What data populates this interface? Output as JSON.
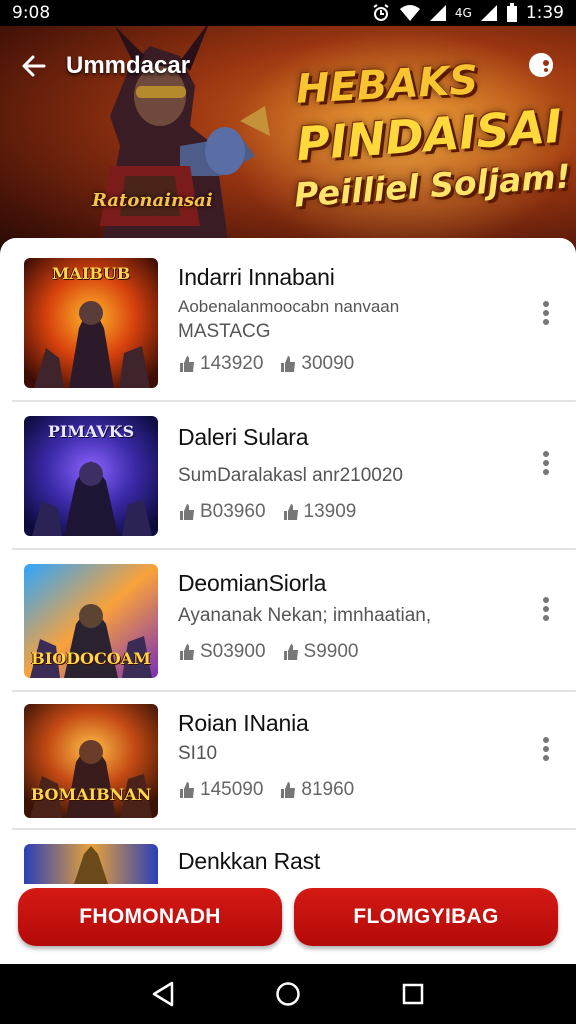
{
  "status_bar": {
    "time": "9:08",
    "clock": "1:39"
  },
  "header": {
    "title": "Ummdacar",
    "promo_line1": "HEBAKS",
    "promo_line2": "PINDAISAI",
    "promo_line3": "Peilliel Soljam!",
    "hero_badge": "Ratonainsai"
  },
  "games": [
    {
      "title": "Indarri Innabani",
      "subtitle": "Aobenalanmoocabn nanvaan",
      "subtitle2": "MASTACG",
      "stat1": "143920",
      "stat2": "30090",
      "thumb_label": "MAIBUB"
    },
    {
      "title": "Daleri Sulara",
      "subtitle": "SumDaralakasl anr210020",
      "subtitle2": "",
      "stat1": "B03960",
      "stat2": "13909",
      "thumb_label": "PIMAVKS"
    },
    {
      "title": "DeomianSiorla",
      "subtitle": "Ayananak Nekan; imnhaatian,",
      "subtitle2": "",
      "stat1": "S03900",
      "stat2": "S9900",
      "thumb_label": "BIODOCOAM"
    },
    {
      "title": "Roian INania",
      "subtitle": "SI10",
      "subtitle2": "",
      "stat1": "145090",
      "stat2": "81960",
      "thumb_label": "BOMAIBNAN"
    },
    {
      "title": "Denkkan Rast",
      "subtitle": "",
      "subtitle2": "",
      "stat1": "",
      "stat2": "",
      "thumb_label": ""
    }
  ],
  "buttons": {
    "left": "FHOMONADH",
    "right": "FLOMGYIBAG"
  },
  "colors": {
    "accent": "#c8110d",
    "hero": "#9a3511"
  }
}
